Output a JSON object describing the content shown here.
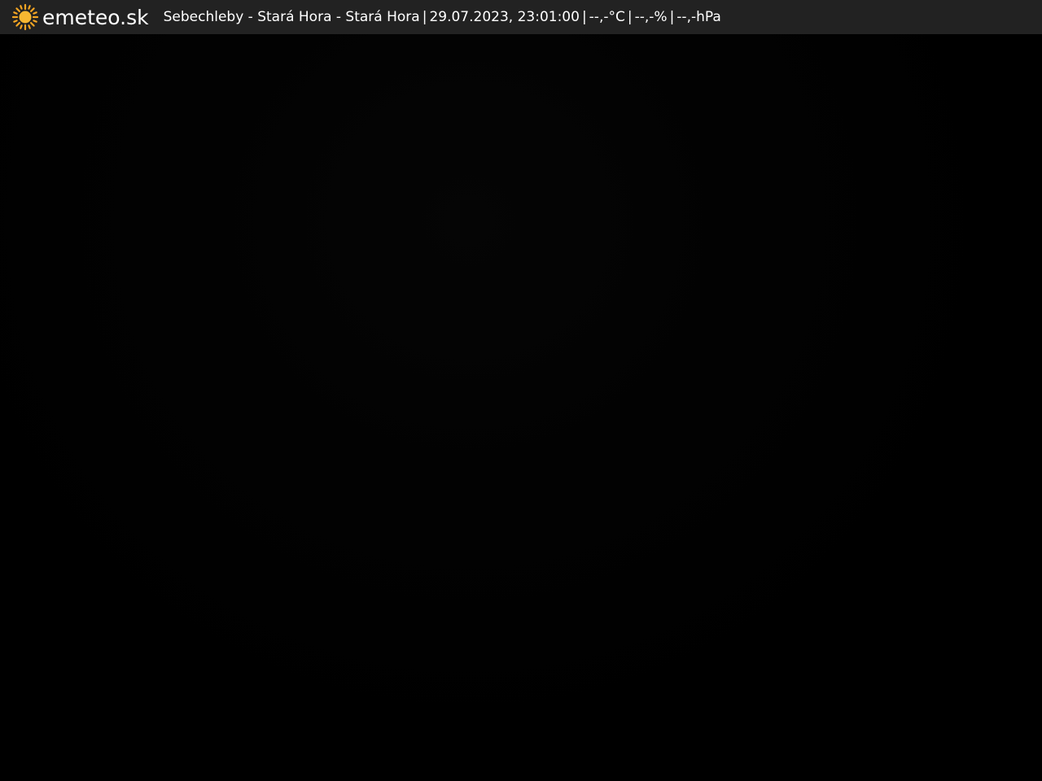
{
  "brand": {
    "name": "emeteo.sk",
    "icon": "sun-icon",
    "icon_color": "#f5a623"
  },
  "caption": {
    "location": "Sebechleby - Stará Hora - Stará Hora",
    "separator": "|",
    "datetime": "29.07.2023, 23:01:00",
    "temperature": "--,-°C",
    "humidity": "--,-%",
    "pressure": "--,-hPa"
  },
  "colors": {
    "bar_background": "#222222",
    "text": "#ffffff",
    "image_background": "#000000"
  }
}
